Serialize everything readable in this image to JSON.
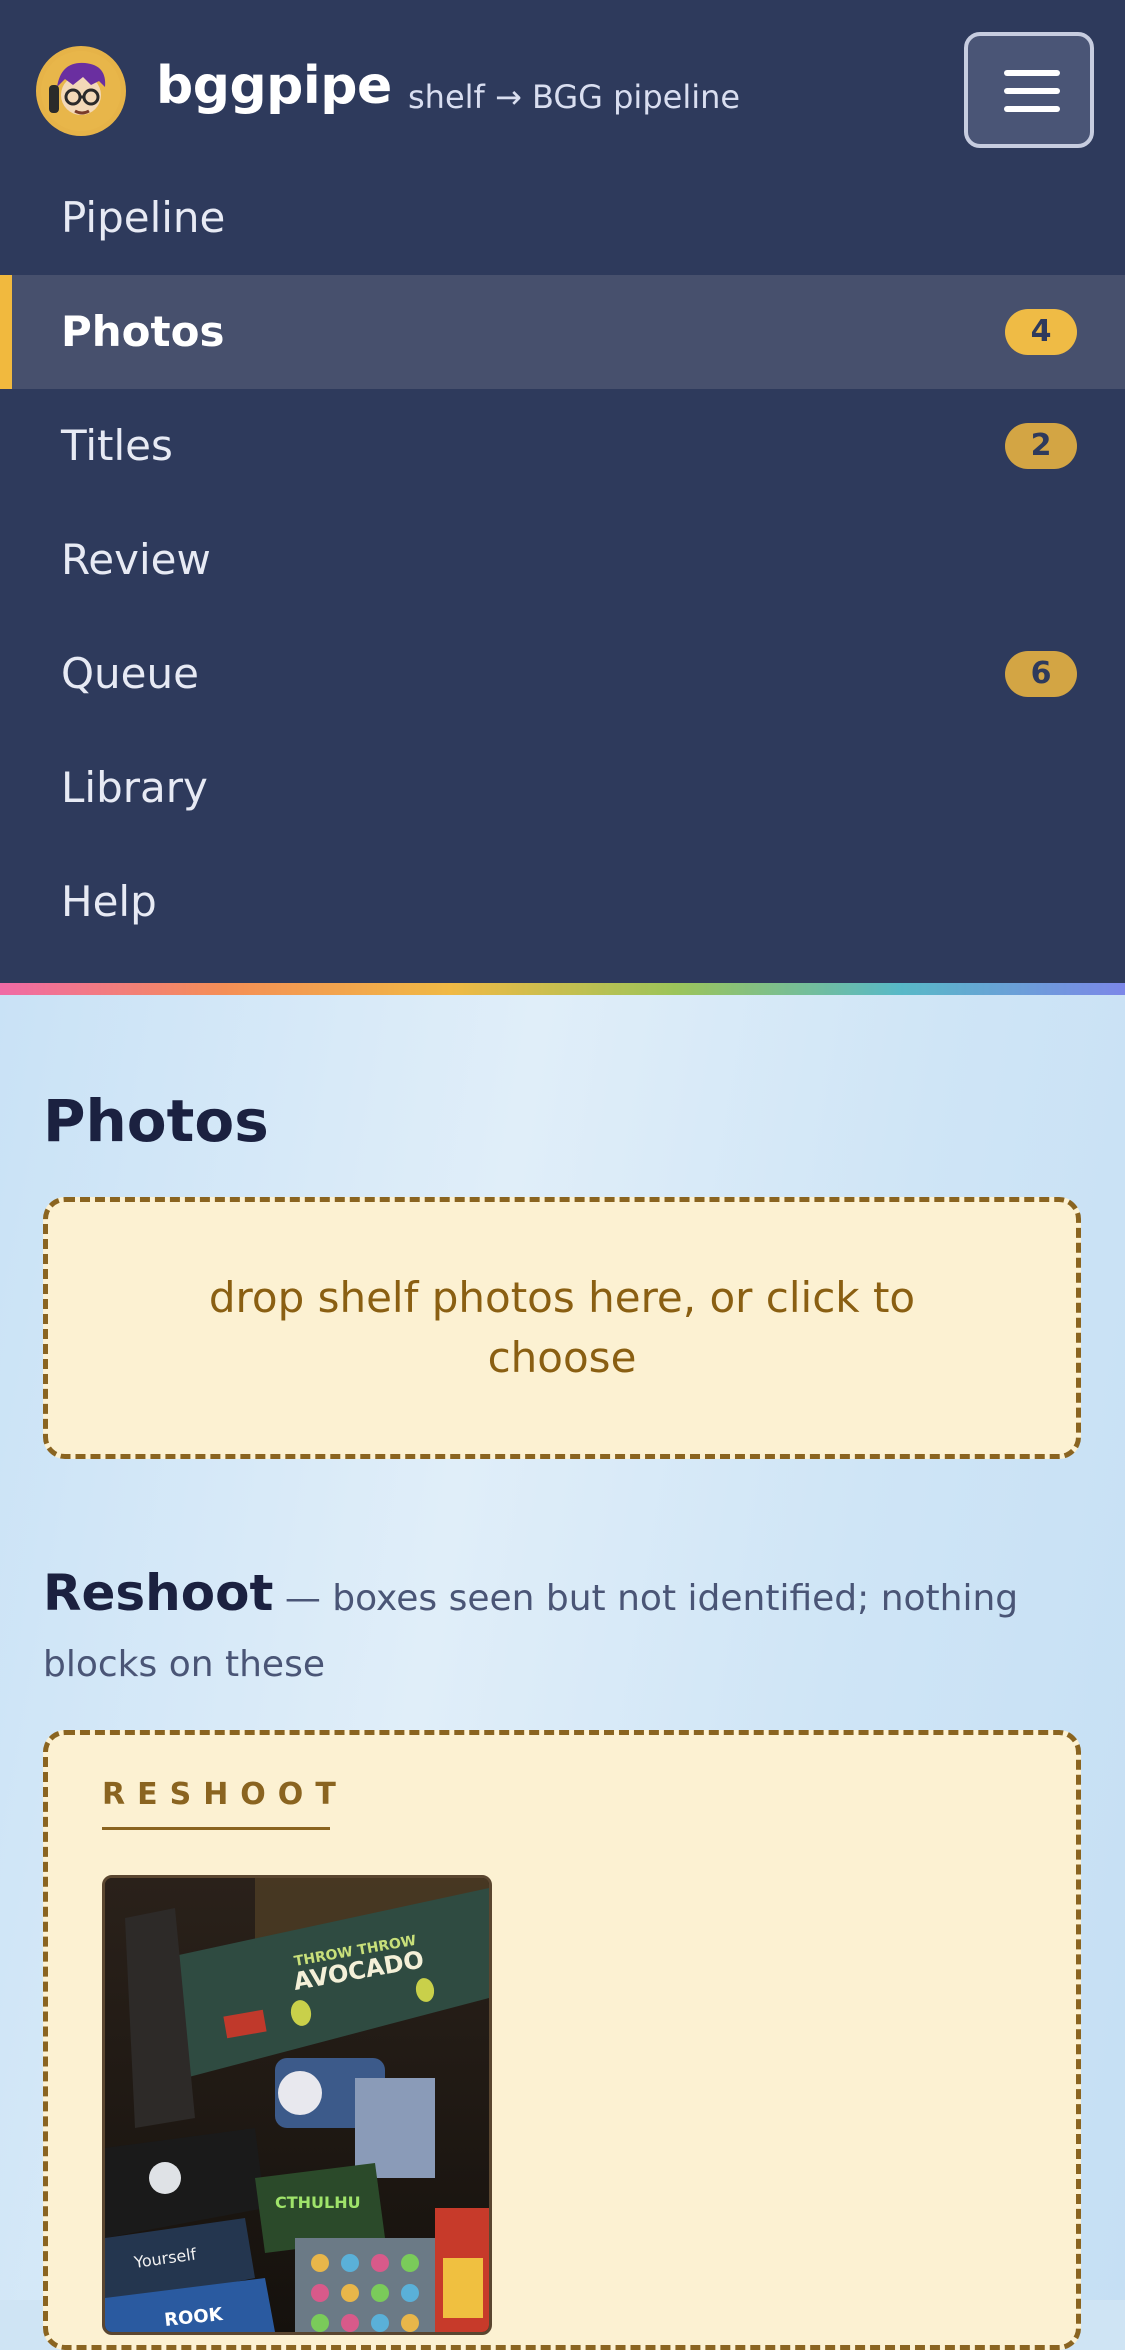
{
  "header": {
    "app_name": "bggpipe",
    "tagline": "shelf → BGG pipeline",
    "avatar_icon": "user-avatar-icon",
    "menu_icon": "hamburger-menu-icon"
  },
  "nav": {
    "items": [
      {
        "label": "Pipeline",
        "badge": null,
        "active": false
      },
      {
        "label": "Photos",
        "badge": "4",
        "active": true
      },
      {
        "label": "Titles",
        "badge": "2",
        "active": false
      },
      {
        "label": "Review",
        "badge": null,
        "active": false
      },
      {
        "label": "Queue",
        "badge": "6",
        "active": false
      },
      {
        "label": "Library",
        "badge": null,
        "active": false
      },
      {
        "label": "Help",
        "badge": null,
        "active": false
      }
    ]
  },
  "main": {
    "title": "Photos",
    "dropzone_text": "drop shelf photos here, or click to choose",
    "reshoot": {
      "heading": "Reshoot",
      "description": " — boxes seen but not identified; nothing blocks on these",
      "card_label": "RESHOOT",
      "photo_text": [
        "THROW THROW",
        "AVOCADO",
        "ROOK",
        "Yourself"
      ]
    }
  },
  "colors": {
    "nav_bg": "#2e3a5c",
    "accent": "#f1b93e",
    "dropzone_bg": "#fcf1d2",
    "dropzone_border": "#8a6420"
  }
}
